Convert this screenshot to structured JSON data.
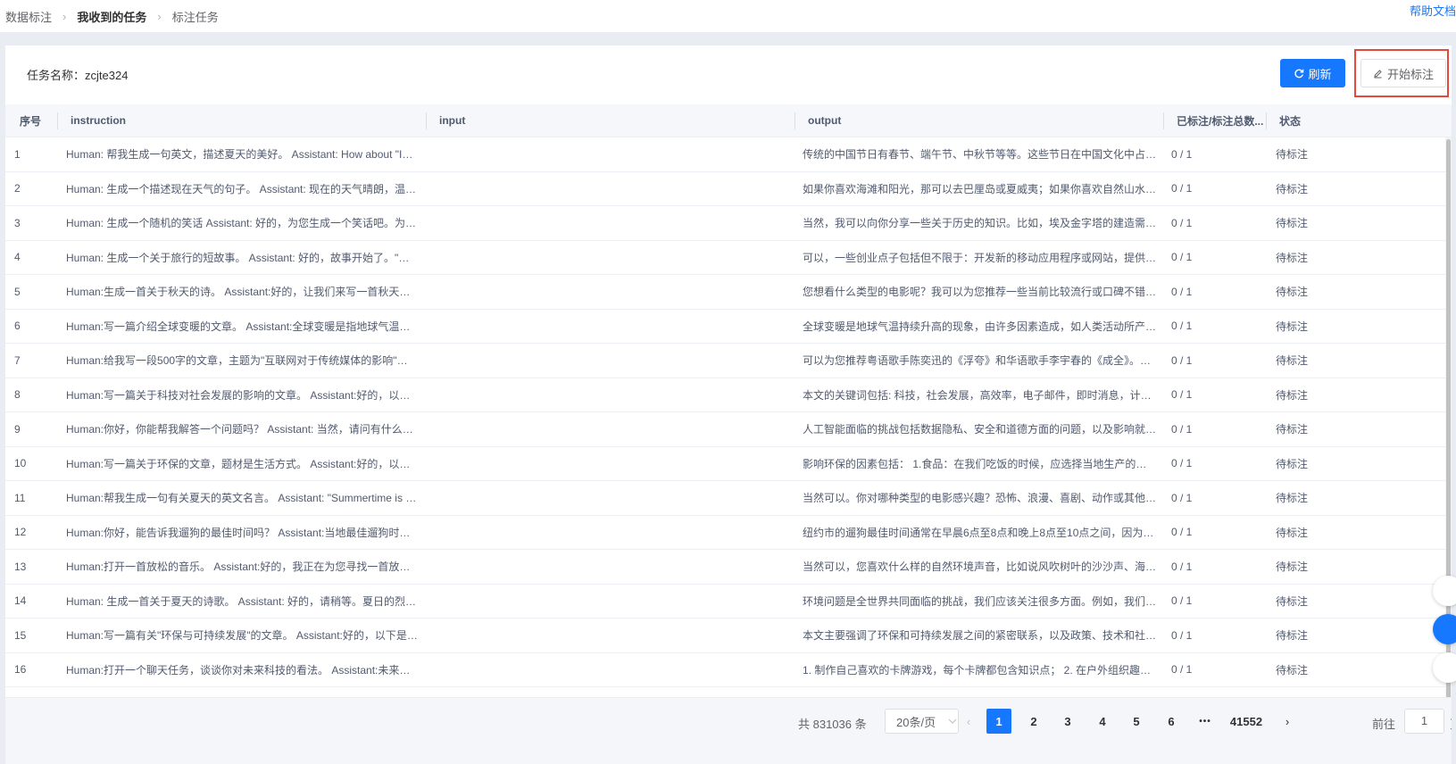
{
  "breadcrumb": [
    "数据标注",
    "我收到的任务",
    "标注任务"
  ],
  "help_link": "帮助文档",
  "task": {
    "label": "任务名称：",
    "name": "zcjte324"
  },
  "buttons": {
    "refresh": "刷新",
    "start": "开始标注"
  },
  "columns": [
    "序号",
    "instruction",
    "input",
    "output",
    "已标注/标注总数...",
    "状态"
  ],
  "rows": [
    {
      "idx": "1",
      "instruction": "Human: 帮我生成一句英文，描述夏天的美好。 Assistant: How about \"In th...",
      "input": "",
      "output": "传统的中国节日有春节、端午节、中秋节等等。这些节日在中国文化中占有...",
      "count": "0 / 1",
      "status": "待标注"
    },
    {
      "idx": "2",
      "instruction": "Human: 生成一个描述现在天气的句子。 Assistant: 现在的天气晴朗，温度...",
      "input": "",
      "output": "如果你喜欢海滩和阳光，那可以去巴厘岛或夏威夷；如果你喜欢自然山水和...",
      "count": "0 / 1",
      "status": "待标注"
    },
    {
      "idx": "3",
      "instruction": "Human: 生成一个随机的笑话 Assistant: 好的，为您生成一个笑话吧。为什...",
      "input": "",
      "output": "当然，我可以向你分享一些关于历史的知识。比如，埃及金字塔的建造需要...",
      "count": "0 / 1",
      "status": "待标注"
    },
    {
      "idx": "4",
      "instruction": "Human: 生成一个关于旅行的短故事。 Assistant: 好的，故事开始了。\"在一...",
      "input": "",
      "output": "可以，一些创业点子包括但不限于：开发新的移动应用程序或网站，提供新...",
      "count": "0 / 1",
      "status": "待标注"
    },
    {
      "idx": "5",
      "instruction": "Human:生成一首关于秋天的诗。 Assistant:好的，让我们来写一首秋天的诗...",
      "input": "",
      "output": "您想看什么类型的电影呢？我可以为您推荐一些当前比较流行或口碑不错的...",
      "count": "0 / 1",
      "status": "待标注"
    },
    {
      "idx": "6",
      "instruction": "Human:写一篇介绍全球变暖的文章。 Assistant:全球变暖是指地球气温持续...",
      "input": "",
      "output": "全球变暖是地球气温持续升高的现象，由许多因素造成，如人类活动所产生...",
      "count": "0 / 1",
      "status": "待标注"
    },
    {
      "idx": "7",
      "instruction": "Human:给我写一段500字的文章，主题为\"互联网对于传统媒体的影响\"。 As...",
      "input": "",
      "output": "可以为您推荐粤语歌手陈奕迅的《浮夸》和华语歌手李宇春的《成全》。陈...",
      "count": "0 / 1",
      "status": "待标注"
    },
    {
      "idx": "8",
      "instruction": "Human:写一篇关于科技对社会发展的影响的文章。 Assistant:好的，以下是...",
      "input": "",
      "output": "本文的关键词包括: 科技，社会发展，高效率，电子邮件，即时消息，计算...",
      "count": "0 / 1",
      "status": "待标注"
    },
    {
      "idx": "9",
      "instruction": "Human:你好，你能帮我解答一个问题吗？ Assistant: 当然，请问有什么问题...",
      "input": "",
      "output": "人工智能面临的挑战包括数据隐私、安全和道德方面的问题，以及影响就业...",
      "count": "0 / 1",
      "status": "待标注"
    },
    {
      "idx": "10",
      "instruction": "Human:写一篇关于环保的文章，题材是生活方式。 Assistant:好的，以下是...",
      "input": "",
      "output": "影响环保的因素包括： 1.食品：在我们吃饭的时候，应选择当地生产的食物...",
      "count": "0 / 1",
      "status": "待标注"
    },
    {
      "idx": "11",
      "instruction": "Human:帮我生成一句有关夏天的英文名言。 Assistant: \"Summertime is alw...",
      "input": "",
      "output": "当然可以。你对哪种类型的电影感兴趣？恐怖、浪漫、喜剧、动作或其他类...",
      "count": "0 / 1",
      "status": "待标注"
    },
    {
      "idx": "12",
      "instruction": "Human:你好，能告诉我遛狗的最佳时间吗？ Assistant:当地最佳遛狗时间因...",
      "input": "",
      "output": "纽约市的遛狗最佳时间通常在早晨6点至8点和晚上8点至10点之间，因为这...",
      "count": "0 / 1",
      "status": "待标注"
    },
    {
      "idx": "13",
      "instruction": "Human:打开一首放松的音乐。 Assistant:好的，我正在为您寻找一首放松的...",
      "input": "",
      "output": "当然可以，您喜欢什么样的自然环境声音，比如说风吹树叶的沙沙声、海浪...",
      "count": "0 / 1",
      "status": "待标注"
    },
    {
      "idx": "14",
      "instruction": "Human: 生成一首关于夏天的诗歌。 Assistant: 好的，请稍等。夏日的烈日...",
      "input": "",
      "output": "环境问题是全世界共同面临的挑战，我们应该关注很多方面。例如，我们应...",
      "count": "0 / 1",
      "status": "待标注"
    },
    {
      "idx": "15",
      "instruction": "Human:写一篇有关\"环保与可持续发展\"的文章。 Assistant:好的，以下是我...",
      "input": "",
      "output": "本文主要强调了环保和可持续发展之间的紧密联系，以及政策、技术和社会...",
      "count": "0 / 1",
      "status": "待标注"
    },
    {
      "idx": "16",
      "instruction": "Human:打开一个聊天任务，谈谈你对未来科技的看法。 Assistant:未来科技...",
      "input": "",
      "output": "1. 制作自己喜欢的卡牌游戏，每个卡牌都包含知识点； 2. 在户外组织趣味...",
      "count": "0 / 1",
      "status": "待标注"
    }
  ],
  "pagination": {
    "total": "共 831036 条",
    "page_size": "20条/页",
    "pages": [
      "1",
      "2",
      "3",
      "4",
      "5",
      "6"
    ],
    "ellipsis": "•••",
    "last_page": "41552",
    "current": "1",
    "goto_label": "前往",
    "goto_value": "1",
    "goto_suffix": "页"
  },
  "colors": {
    "primary": "#1677ff",
    "highlight_border": "#e8473b"
  }
}
